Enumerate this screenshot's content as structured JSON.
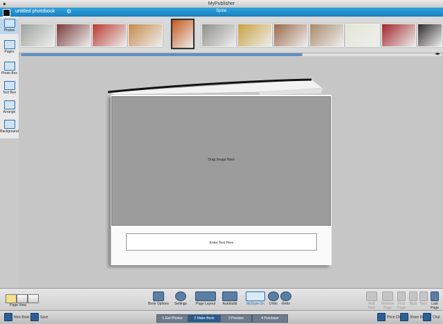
{
  "window": {
    "title": "MyPublisher"
  },
  "project": {
    "title": "untitled photobook",
    "spine_label": "Spine"
  },
  "sidebar": {
    "tabs": [
      {
        "label": "Photos",
        "icon": "photos-icon",
        "active": true
      },
      {
        "label": "Pages",
        "icon": "pages-icon",
        "active": false
      }
    ],
    "tools": [
      {
        "label": "Photo Box",
        "icon": "photo-box-icon"
      },
      {
        "label": "Text Box",
        "icon": "text-box-icon"
      },
      {
        "label": "Arrange",
        "icon": "arrange-icon"
      },
      {
        "label": "Background",
        "icon": "background-icon"
      }
    ]
  },
  "thumbnails": [
    {
      "name": "toy cars group",
      "color": "#9aa39a"
    },
    {
      "name": "red blue toy car",
      "color": "#7a3a3a"
    },
    {
      "name": "red toy racer",
      "color": "#b83a30"
    },
    {
      "name": "orange toy cars",
      "color": "#c58a4a"
    },
    {
      "name": "orange toy truck upright",
      "color": "#c55a1c"
    },
    {
      "name": "silver toy cars",
      "color": "#8e8e8a"
    },
    {
      "name": "yellow toy car",
      "color": "#c8a040"
    },
    {
      "name": "brown toy car",
      "color": "#9a6a4a"
    },
    {
      "name": "beige toy car",
      "color": "#a88a6a"
    },
    {
      "name": "green toy car",
      "color": "#e4e6d4"
    },
    {
      "name": "red toy sedan",
      "color": "#a0262a"
    },
    {
      "name": "dark toy car",
      "color": "#2e2a2a"
    }
  ],
  "canvas": {
    "photo_placeholder": "Drag Image Here",
    "text_placeholder": "Enter Text Here"
  },
  "page_view": {
    "label": "Page View"
  },
  "toolbar": {
    "items": [
      {
        "label": "Book Options",
        "icon": "book-options-icon"
      },
      {
        "label": "Settings",
        "icon": "settings-icon"
      },
      {
        "label": "Page Layout",
        "icon": "page-layout-icon"
      },
      {
        "label": "Autobuild",
        "icon": "autobuild-icon"
      },
      {
        "label": "MyStyle On",
        "icon": "mystyle-icon"
      },
      {
        "label": "Undo",
        "icon": "undo-icon"
      },
      {
        "label": "Redo",
        "icon": "redo-icon"
      }
    ],
    "page_controls": [
      {
        "label": "Add New Page",
        "icon": "add-page-icon",
        "enabled": false
      },
      {
        "label": "Remove Page",
        "icon": "remove-page-icon",
        "enabled": false
      },
      {
        "label": "First Page",
        "icon": "first-page-icon",
        "enabled": false
      },
      {
        "label": "Back",
        "icon": "back-icon",
        "enabled": false
      },
      {
        "label": "Next",
        "icon": "next-icon",
        "enabled": false
      },
      {
        "label": "Last Page",
        "icon": "last-page-icon",
        "enabled": true
      }
    ]
  },
  "status": {
    "new_book": "New Book",
    "save": "Save",
    "steps": [
      {
        "label": "1  Get Photos",
        "active": false
      },
      {
        "label": "2  Make Book",
        "active": true
      },
      {
        "label": "3  Preview",
        "active": false
      },
      {
        "label": "4  Purchase",
        "active": false
      }
    ],
    "price_check": "Price Check",
    "share_book": "Share Book",
    "chat": "Chat"
  },
  "colors": {
    "accent": "#1f8cd0",
    "photo_placeholder": "#9c9c9c",
    "active_step": "#2a5b8e"
  }
}
